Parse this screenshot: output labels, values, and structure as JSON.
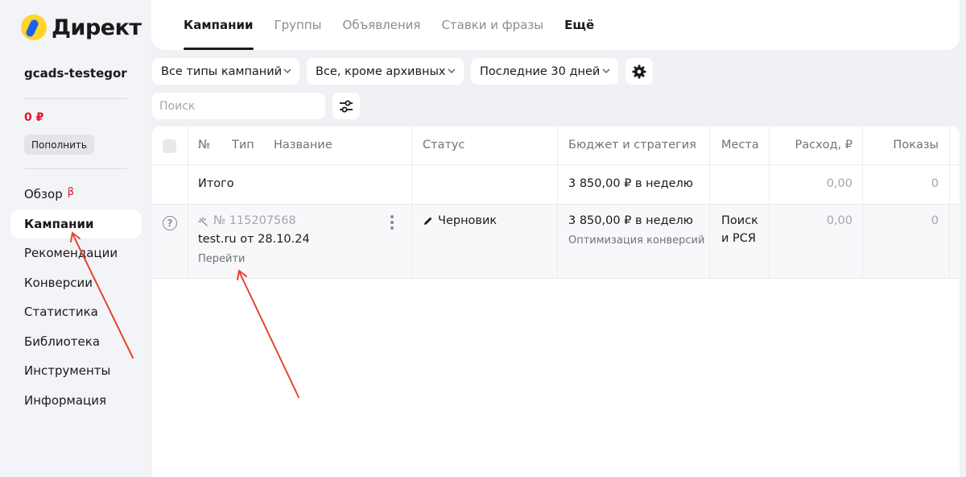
{
  "brand": {
    "name": "Директ"
  },
  "sidebar": {
    "account": "gcads-testegor",
    "balance": "0 ₽",
    "topup_label": "Пополнить",
    "items": [
      {
        "label": "Обзор",
        "badge": "β"
      },
      {
        "label": "Кампании",
        "active": true
      },
      {
        "label": "Рекомендации"
      },
      {
        "label": "Конверсии"
      },
      {
        "label": "Статистика"
      },
      {
        "label": "Библиотека"
      },
      {
        "label": "Инструменты"
      },
      {
        "label": "Информация"
      }
    ]
  },
  "tabs": [
    {
      "label": "Кампании",
      "active": true
    },
    {
      "label": "Группы"
    },
    {
      "label": "Объявления"
    },
    {
      "label": "Ставки и фразы"
    },
    {
      "label": "Ещё"
    }
  ],
  "filters": {
    "campaign_types": "Все типы кампаний",
    "archive": "Все, кроме архивных",
    "period": "Последние 30 дней",
    "search_placeholder": "Поиск",
    "settings_icon": "gear-icon",
    "filter_icon": "sliders-icon"
  },
  "table": {
    "headers": {
      "number": "№",
      "type": "Тип",
      "name": "Название",
      "status": "Статус",
      "budget": "Бюджет и стратегия",
      "places": "Места",
      "spend": "Расход, ₽",
      "impressions": "Показы"
    },
    "total": {
      "label": "Итого",
      "budget": "3 850,00 ₽ в неделю",
      "spend": "0,00",
      "impressions": "0"
    },
    "rows": [
      {
        "number": "№ 115207568",
        "name": "test.ru от 28.10.24",
        "link": "Перейти",
        "status": "Черновик",
        "budget": "3 850,00 ₽ в неделю",
        "strategy": "Оптимизация конверсий",
        "places_line1": "Поиск",
        "places_line2": "и РСЯ",
        "spend": "0,00",
        "impressions": "0"
      }
    ]
  },
  "colors": {
    "accent_red": "#e0162b",
    "annotation_arrow": "#e2452f",
    "logo_yellow": "#fed42b",
    "logo_blue": "#1f5ff0"
  }
}
